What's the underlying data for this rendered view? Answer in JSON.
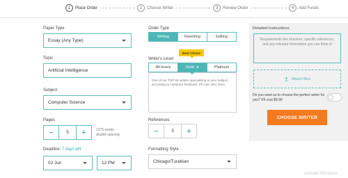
{
  "steps": [
    {
      "num": "1",
      "label": "Place Order"
    },
    {
      "num": "2",
      "label": "Choose Writer"
    },
    {
      "num": "3",
      "label": "Review Order"
    },
    {
      "num": "4",
      "label": "Add Funds"
    }
  ],
  "paper_type": {
    "label": "Paper Type",
    "value": "Essay (Any Type)"
  },
  "topic": {
    "label": "Topic",
    "value": "Artificial Intelligence"
  },
  "subject": {
    "label": "Subject",
    "value": "Computer Science"
  },
  "pages": {
    "label": "Pages",
    "value": "5",
    "minus": "−",
    "plus": "+",
    "words": "1375 words",
    "spacing": "double spacing"
  },
  "deadline": {
    "label": "Deadline:",
    "days": "7 days left",
    "date": "02 Jun",
    "time": "12 PM"
  },
  "order_type": {
    "label": "Order Type",
    "options": [
      "Writing",
      "Rewriting",
      "Editing"
    ],
    "selected": "Writing"
  },
  "writer_level": {
    "label": "Writer's Level",
    "badge": "Best Choice",
    "options": [
      "All levels",
      "Gold",
      "Platinum"
    ],
    "selected": "Gold",
    "description": "One of our TOP 50 writers specializing in your subject according to customer feedback. It'll cost 10% more."
  },
  "references": {
    "label": "References",
    "value": "3",
    "minus": "−",
    "plus": "+"
  },
  "formatting": {
    "label": "Formatting Style",
    "value": "Chicago/Turabian"
  },
  "panel": {
    "title": "Detailed Instructions",
    "placeholder": "Requirements like structure, specific references, and any relevant information you can think of",
    "attach_label": "Attach files",
    "pref_text": "Do you want us to choose the perfect writer for you? It'll cost $9.99",
    "cta_label": "CHOOSE WRITER"
  },
  "watermark": "Activate Windows",
  "colors": {
    "accent": "#4db6b6",
    "cta": "#f47a1f",
    "badge": "#f6c800"
  }
}
